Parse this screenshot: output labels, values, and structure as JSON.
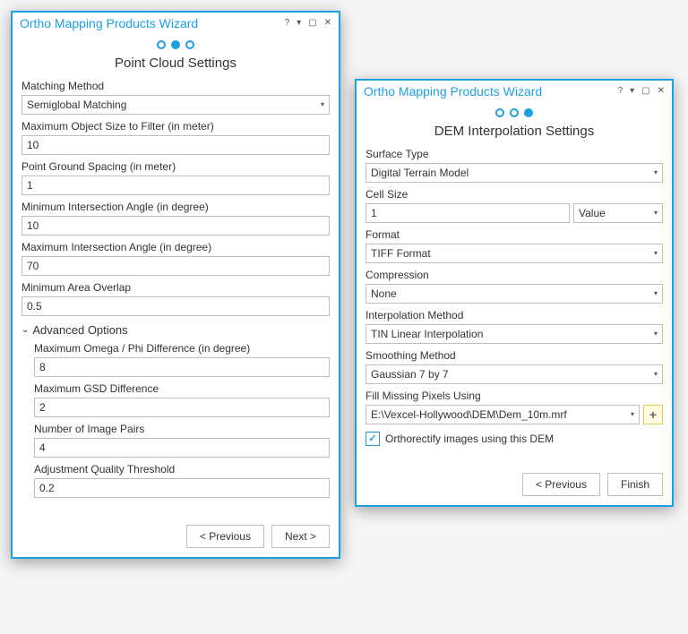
{
  "left": {
    "title": "Ortho Mapping Products Wizard",
    "page_title": "Point Cloud Settings",
    "fields": {
      "matching_method": {
        "label": "Matching Method",
        "value": "Semiglobal Matching"
      },
      "max_obj_size": {
        "label": "Maximum Object Size to Filter (in meter)",
        "value": "10"
      },
      "ground_spacing": {
        "label": "Point Ground Spacing (in meter)",
        "value": "1"
      },
      "min_intersection": {
        "label": "Minimum Intersection Angle (in degree)",
        "value": "10"
      },
      "max_intersection": {
        "label": "Maximum Intersection Angle (in degree)",
        "value": "70"
      },
      "min_overlap": {
        "label": "Minimum Area Overlap",
        "value": "0.5"
      }
    },
    "advanced_label": "Advanced Options",
    "advanced": {
      "omega_phi": {
        "label": "Maximum Omega / Phi Difference (in degree)",
        "value": "8"
      },
      "gsd_diff": {
        "label": "Maximum GSD Difference",
        "value": "2"
      },
      "image_pairs": {
        "label": "Number of Image Pairs",
        "value": "4"
      },
      "quality_threshold": {
        "label": "Adjustment Quality Threshold",
        "value": "0.2"
      }
    },
    "buttons": {
      "previous": "< Previous",
      "next": "Next >"
    }
  },
  "right": {
    "title": "Ortho Mapping Products Wizard",
    "page_title": "DEM Interpolation Settings",
    "fields": {
      "surface_type": {
        "label": "Surface Type",
        "value": "Digital Terrain Model"
      },
      "cell_size": {
        "label": "Cell Size",
        "value": "1",
        "unit": "Value"
      },
      "format": {
        "label": "Format",
        "value": "TIFF Format"
      },
      "compression": {
        "label": "Compression",
        "value": "None"
      },
      "interp_method": {
        "label": "Interpolation Method",
        "value": "TIN Linear Interpolation"
      },
      "smoothing": {
        "label": "Smoothing Method",
        "value": "Gaussian 7 by 7"
      },
      "fill_missing": {
        "label": "Fill Missing Pixels Using",
        "value": "E:\\Vexcel-Hollywood\\DEM\\Dem_10m.mrf"
      }
    },
    "orthorectify_label": "Orthorectify images using this DEM",
    "orthorectify_checked": "✓",
    "buttons": {
      "previous": "< Previous",
      "finish": "Finish"
    }
  }
}
